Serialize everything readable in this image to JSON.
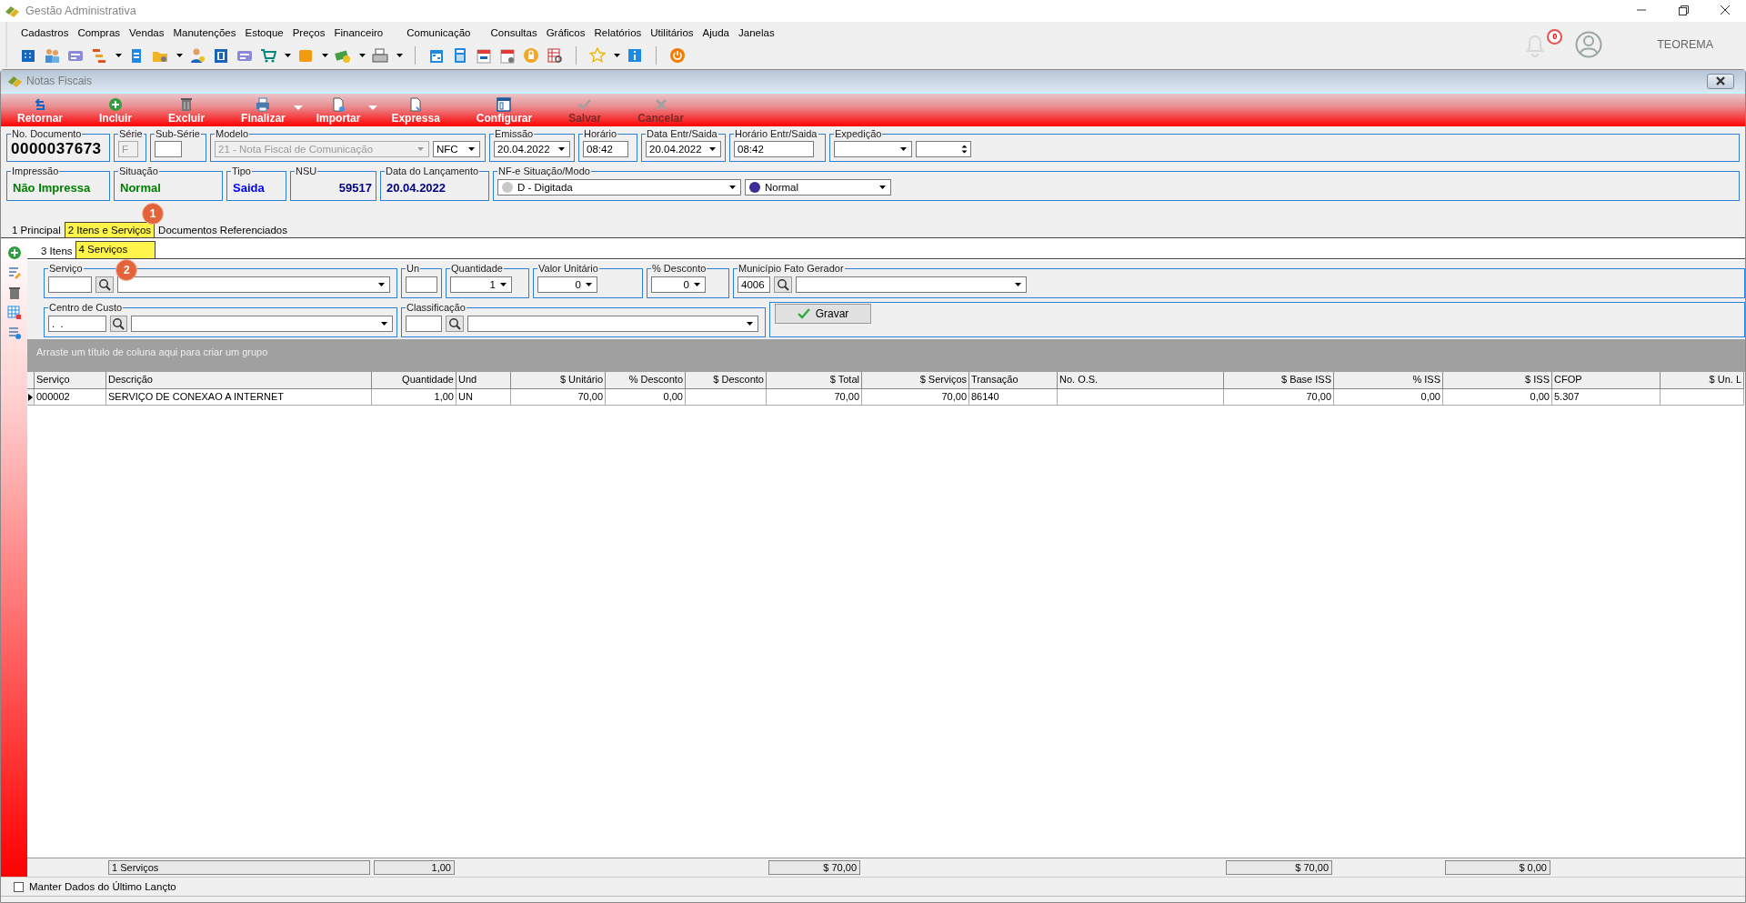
{
  "app": {
    "title": "Gestão Administrativa"
  },
  "menu": [
    "Cadastros",
    "Compras",
    "Vendas",
    "Manutenções",
    "Estoque",
    "Preços",
    "Financeiro",
    "Comunicação",
    "Consultas",
    "Gráficos",
    "Relatórios",
    "Utilitários",
    "Ajuda",
    "Janelas"
  ],
  "user": {
    "notifications": "0",
    "name": "TEOREMA"
  },
  "window": {
    "title": "Notas Fiscais"
  },
  "actions": [
    {
      "label": "Retornar",
      "disabled": false,
      "menu": false
    },
    {
      "label": "Incluir",
      "disabled": false,
      "menu": false
    },
    {
      "label": "Excluir",
      "disabled": false,
      "menu": false
    },
    {
      "label": "Finalizar",
      "disabled": false,
      "menu": true
    },
    {
      "label": "Importar",
      "disabled": false,
      "menu": true
    },
    {
      "label": "Expressa",
      "disabled": false,
      "menu": false
    },
    {
      "label": "Configurar",
      "disabled": false,
      "menu": false
    },
    {
      "label": "Salvar",
      "disabled": true,
      "menu": false
    },
    {
      "label": "Cancelar",
      "disabled": true,
      "menu": false
    }
  ],
  "header_row1": [
    {
      "label": "No. Documento",
      "fields": [
        {
          "kind": "big",
          "value": "0000037673"
        }
      ]
    },
    {
      "label": "Série",
      "fields": [
        {
          "kind": "input",
          "value": "F",
          "disabled": true
        }
      ]
    },
    {
      "label": "Sub-Série",
      "fields": [
        {
          "kind": "input",
          "disabled": false
        }
      ]
    },
    {
      "label": "Modelo",
      "fields": [
        {
          "kind": "select",
          "value": "21 - Nota Fiscal de Comunicação",
          "disabled": true
        },
        {
          "kind": "select",
          "value": "NFC",
          "disabled": false
        }
      ]
    },
    {
      "label": "Emissão",
      "fields": [
        {
          "kind": "select",
          "value": "20.04.2022",
          "disabled": false
        }
      ]
    },
    {
      "label": "Horário",
      "fields": [
        {
          "kind": "input",
          "value": "08:42",
          "disabled": false
        }
      ]
    },
    {
      "label": "Data Entr/Saida",
      "fields": [
        {
          "kind": "select",
          "value": "20.04.2022",
          "disabled": false
        }
      ]
    },
    {
      "label": "Horário Entr/Saida",
      "fields": [
        {
          "kind": "input",
          "value": "08:42",
          "disabled": false
        }
      ]
    },
    {
      "label": "Expedição",
      "fields": [
        {
          "kind": "select",
          "disabled": false
        },
        {
          "kind": "spin"
        }
      ]
    }
  ],
  "header_row2": [
    {
      "label": "Impressão",
      "fields": [
        {
          "kind": "display",
          "value": "Não Impressa",
          "color": "#008000"
        }
      ]
    },
    {
      "label": "Situação",
      "fields": [
        {
          "kind": "display",
          "value": "Normal",
          "color": "#008000"
        }
      ]
    },
    {
      "label": "Tipo",
      "fields": [
        {
          "kind": "display",
          "value": "Saida",
          "color": "#0000ff"
        }
      ]
    },
    {
      "label": "NSU",
      "fields": [
        {
          "kind": "numeric",
          "value": "59517",
          "color": "#000080"
        }
      ]
    },
    {
      "label": "Data do Lançamento",
      "fields": [
        {
          "kind": "display",
          "value": "20.04.2022",
          "color": "#000080"
        }
      ]
    },
    {
      "label": "NF-e Situação/Modo",
      "fields": [
        {
          "kind": "select",
          "value": "D - Digitada",
          "color": "#c8c8c8",
          "disabled": false
        },
        {
          "kind": "select",
          "value": "Normal",
          "color": "#3c2c96",
          "disabled": false
        }
      ]
    }
  ],
  "tabs": [
    {
      "label": "1 Principal",
      "selected": false,
      "highlighted": false
    },
    {
      "label": "2 Itens e Serviços",
      "selected": true,
      "highlighted": true,
      "callout": "1"
    },
    {
      "label": "Documentos Referenciados",
      "selected": false,
      "highlighted": false
    }
  ],
  "subtabs": [
    {
      "label": "3 Itens",
      "selected": false,
      "highlighted": false
    },
    {
      "label": "4 Serviços",
      "selected": true,
      "highlighted": true,
      "callout": "2"
    }
  ],
  "service_row1": [
    {
      "label": "Serviço",
      "fields": [
        {
          "kind": "input",
          "disabled": false
        },
        {
          "kind": "search"
        },
        {
          "kind": "select",
          "disabled": false
        }
      ]
    },
    {
      "label": "Un",
      "fields": [
        {
          "kind": "input",
          "disabled": false
        }
      ]
    },
    {
      "label": "Quantidade",
      "fields": [
        {
          "kind": "numselect",
          "value": "1"
        }
      ]
    },
    {
      "label": "Valor Unitário",
      "fields": [
        {
          "kind": "numselect",
          "value": "0"
        }
      ]
    },
    {
      "label": "% Desconto",
      "fields": [
        {
          "kind": "numselect",
          "value": "0"
        }
      ]
    },
    {
      "label": "Município Fato Gerador",
      "fields": [
        {
          "kind": "input",
          "value": "4006",
          "disabled": false
        },
        {
          "kind": "search"
        },
        {
          "kind": "select",
          "disabled": false
        }
      ]
    }
  ],
  "service_row2": [
    {
      "label": "Centro de Custo",
      "fields": [
        {
          "kind": "input",
          "value": ".  .",
          "disabled": false
        },
        {
          "kind": "search"
        },
        {
          "kind": "select",
          "disabled": false
        }
      ]
    },
    {
      "label": "Classificação",
      "fields": [
        {
          "kind": "input",
          "disabled": false
        },
        {
          "kind": "search"
        },
        {
          "kind": "select",
          "disabled": false
        }
      ]
    },
    {
      "fields": [
        {
          "kind": "button",
          "value": "Gravar"
        }
      ]
    }
  ],
  "group_panel": "Arraste um título de coluna aqui para criar um grupo",
  "grid": {
    "columns": [
      {
        "label": "Serviço"
      },
      {
        "label": "Descrição",
        "total": "1 Serviços"
      },
      {
        "label": "Quantidade",
        "total": "1,00"
      },
      {
        "label": "Und"
      },
      {
        "label": "$ Unitário"
      },
      {
        "label": "% Desconto"
      },
      {
        "label": "$ Desconto"
      },
      {
        "label": "$ Total",
        "total": "$ 70,00"
      },
      {
        "label": "$ Serviços"
      },
      {
        "label": "Transação"
      },
      {
        "label": "No. O.S."
      },
      {
        "label": "$ Base ISS",
        "total": "$ 70,00"
      },
      {
        "label": "% ISS"
      },
      {
        "label": "$ ISS",
        "total": "$ 0,00"
      },
      {
        "label": "CFOP"
      },
      {
        "label": "$ Un. L"
      }
    ],
    "rows": [
      {
        "current": true,
        "cells": [
          "000002",
          "SERVIÇO DE CONEXAO A INTERNET",
          "1,00",
          "UN",
          "70,00",
          "0,00",
          "",
          "70,00",
          "70,00",
          "86140",
          "",
          "70,00",
          "0,00",
          "0,00",
          "5.307",
          ""
        ]
      }
    ]
  },
  "keep_data": {
    "label": "Manter Dados do Último Lançto",
    "checked": false
  }
}
